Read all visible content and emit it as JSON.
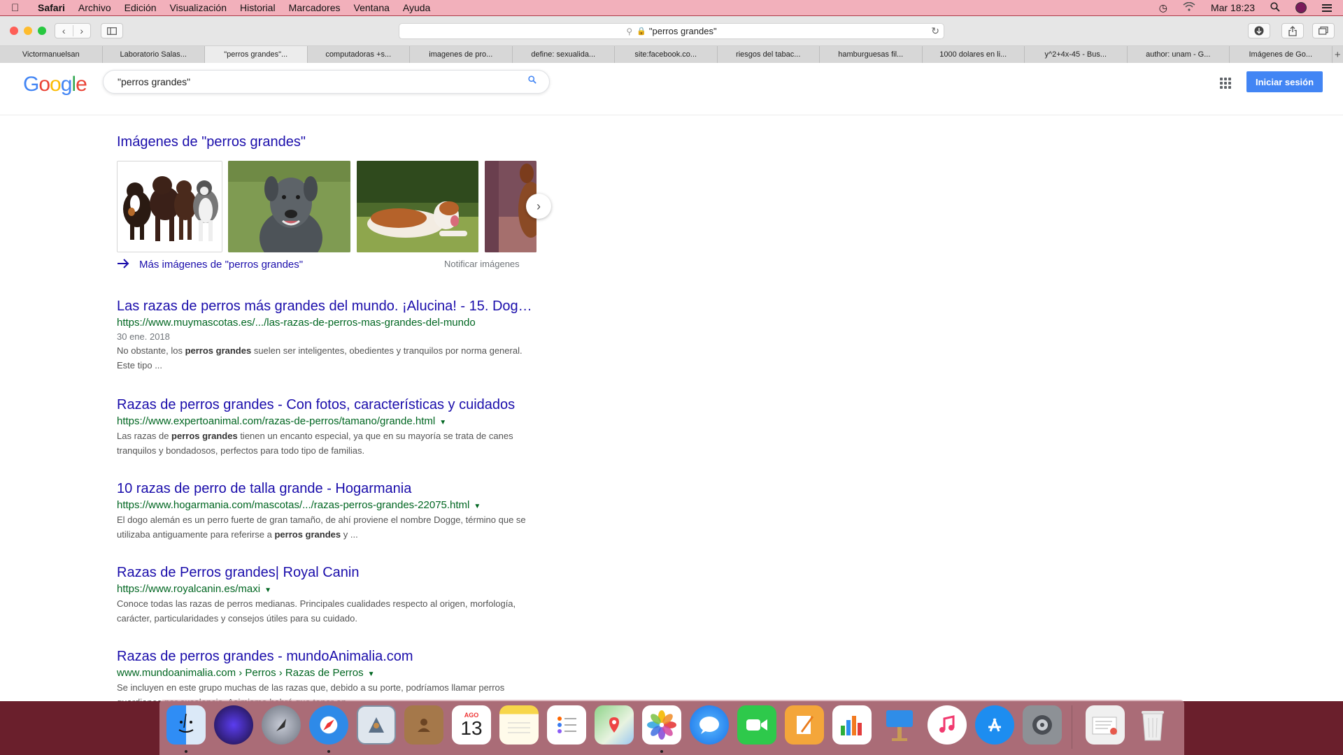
{
  "menubar": {
    "items": [
      "Safari",
      "Archivo",
      "Edición",
      "Visualización",
      "Historial",
      "Marcadores",
      "Ventana",
      "Ayuda"
    ],
    "clock": "Mar 18:23"
  },
  "browser": {
    "address": "\"perros grandes\"",
    "tabs": [
      "Victormanuelsan",
      "Laboratorio Salas...",
      "\"perros grandes\"...",
      "computadoras +s...",
      "imagenes de pro...",
      "define: sexualida...",
      "site:facebook.co...",
      "riesgos del tabac...",
      "hamburguesas fil...",
      "1000 dolares en li...",
      "y^2+4x-45 - Bus...",
      "author: unam - G...",
      "Imágenes de Go..."
    ],
    "active_tab_index": 2,
    "new_tab": "+"
  },
  "google": {
    "logo": "Google",
    "logo_colors": [
      "#4285f4",
      "#ea4335",
      "#fbbc05",
      "#4285f4",
      "#34a853",
      "#ea4335"
    ],
    "query": "\"perros grandes\"",
    "signin": "Iniciar sesión"
  },
  "images": {
    "heading": "Imágenes de \"perros grandes\"",
    "more": "Más imágenes de \"perros grandes\"",
    "report": "Notificar imágenes"
  },
  "results": [
    {
      "title": "Las razas de perros más grandes del mundo. ¡Alucina! - 15. Dog…",
      "url": "https://www.muymascotas.es/.../las-razas-de-perros-mas-grandes-del-mundo",
      "date": "30 ene. 2018",
      "snippet": [
        "No obstante, los ",
        "perros grandes",
        " suelen ser inteligentes, obedientes y tranquilos por norma general. Este tipo ..."
      ]
    },
    {
      "title": "Razas de perros grandes - Con fotos, características y cuidados",
      "url": "https://www.expertoanimal.com/razas-de-perros/tamano/grande.html",
      "snippet": [
        "Las razas de ",
        "perros grandes",
        " tienen un encanto especial, ya que en su mayoría se trata de canes tranquilos y bondadosos, perfectos para todo tipo de familias."
      ]
    },
    {
      "title": "10 razas de perro de talla grande - Hogarmania",
      "url": "https://www.hogarmania.com/mascotas/.../razas-perros-grandes-22075.html",
      "snippet": [
        "El dogo alemán es un perro fuerte de gran tamaño, de ahí proviene el nombre Dogge, término que se utilizaba antiguamente para referirse a ",
        "perros grandes",
        " y  ..."
      ]
    },
    {
      "title": "Razas de Perros grandes| Royal Canin",
      "url": "https://www.royalcanin.es/maxi",
      "snippet": [
        "Conoce todas las razas de perros medianas. Principales cualidades respecto al origen, morfología, carácter, particularidades y consejos útiles para su cuidado.",
        "",
        ""
      ]
    },
    {
      "title": "Razas de perros grandes - mundoAnimalia.com",
      "url": "www.mundoanimalia.com › Perros › Razas de Perros",
      "snippet": [
        "Se incluyen en este grupo muchas de las razas que, debido a su porte, podríamos llamar perros guardianes por excelencia. Asimismo habrá que tener en ...",
        "",
        ""
      ]
    }
  ],
  "dock": {
    "calendar_month": "AGO",
    "calendar_day": "13"
  }
}
